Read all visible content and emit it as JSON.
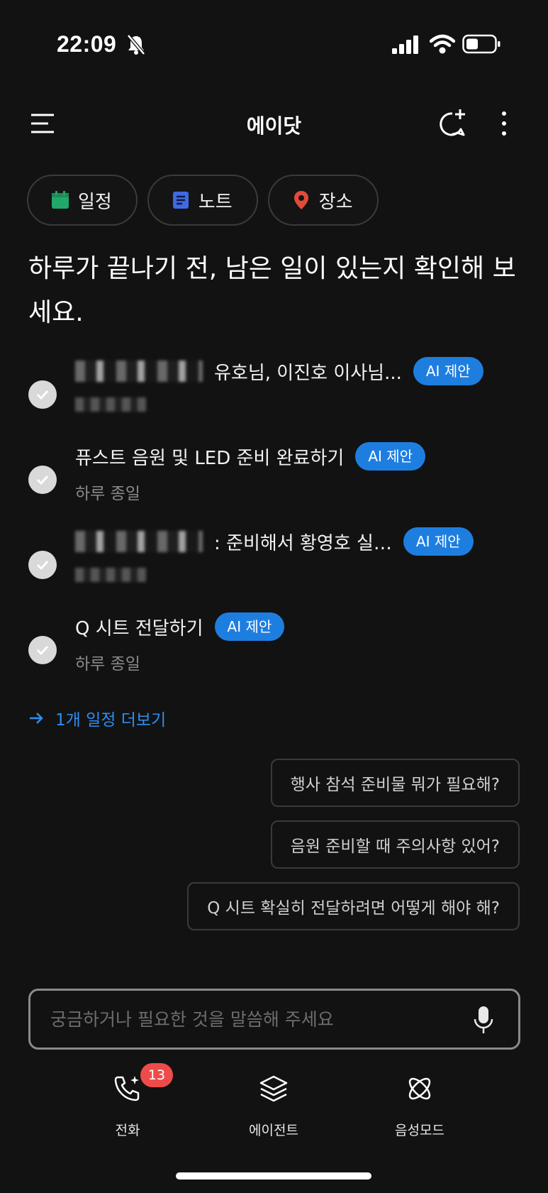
{
  "status_bar": {
    "time": "22:09"
  },
  "header": {
    "title": "에이닷"
  },
  "chips": [
    {
      "label": "일정",
      "icon": "calendar-icon",
      "color": "#22a86b"
    },
    {
      "label": "노트",
      "icon": "note-icon",
      "color": "#3f6ae0"
    },
    {
      "label": "장소",
      "icon": "location-pin-icon",
      "color": "#e24a3a"
    }
  ],
  "headline": "하루가 끝나기 전, 남은 일이 있는지 확인해 보세요.",
  "tasks": [
    {
      "title_visible": "유호님, 이진호 이사님...",
      "badge": "AI 제안",
      "subtitle": ""
    },
    {
      "title_visible": "퓨스트 음원 및 LED 준비 완료하기",
      "badge": "AI 제안",
      "subtitle": "하루 종일"
    },
    {
      "title_visible": ": 준비해서 황영호 실…",
      "badge": "AI 제안",
      "subtitle": ""
    },
    {
      "title_visible": "Q 시트 전달하기",
      "badge": "AI 제안",
      "subtitle": "하루 종일"
    }
  ],
  "more_link": "1개 일정 더보기",
  "suggestions": [
    "행사 참석 준비물 뭐가 필요해?",
    "음원 준비할 때 주의사항 있어?",
    "Q 시트 확실히 전달하려면 어떻게 해야 해?"
  ],
  "input": {
    "placeholder": "궁금하거나 필요한 것을 말씀해 주세요"
  },
  "bottom_nav": [
    {
      "label": "전화",
      "icon": "phone-sparkle-icon",
      "badge": "13"
    },
    {
      "label": "에이전트",
      "icon": "layers-icon"
    },
    {
      "label": "음성모드",
      "icon": "orbit-icon"
    }
  ],
  "colors": {
    "accent": "#1e7ee0",
    "link": "#2f8ef0",
    "badge": "#ef4b4b",
    "background": "#121212"
  }
}
